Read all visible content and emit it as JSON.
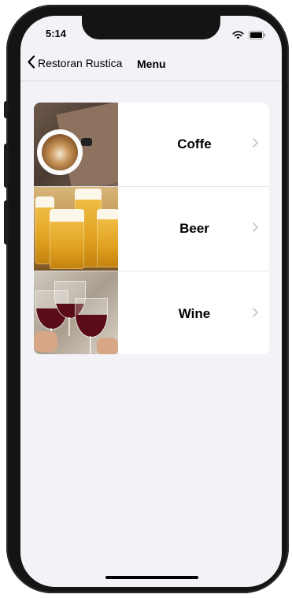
{
  "status_bar": {
    "time": "5:14",
    "icons": [
      "wifi-icon",
      "battery-icon"
    ]
  },
  "navbar": {
    "back_label": "Restoran Rustica",
    "title": "Menu"
  },
  "menu": {
    "items": [
      {
        "label": "Coffe",
        "image": "coffee-latte-image"
      },
      {
        "label": "Beer",
        "image": "beer-mugs-image"
      },
      {
        "label": "Wine",
        "image": "red-wine-glasses-image"
      }
    ]
  },
  "colors": {
    "background": "#f2f2f7",
    "card": "#ffffff",
    "separator": "#e4e4e8",
    "chevron": "#c4c4c9",
    "text": "#000000"
  }
}
